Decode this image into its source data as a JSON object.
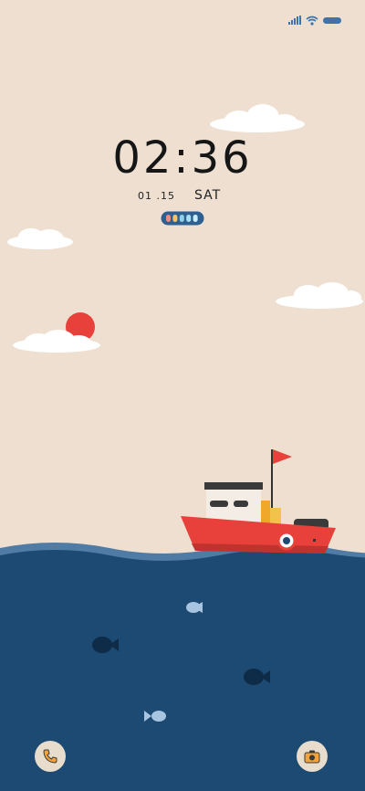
{
  "status_bar": {
    "signal_icon": "cellular-signal-icon",
    "wifi_icon": "wifi-icon",
    "battery_icon": "battery-icon"
  },
  "clock": {
    "time": "02:36",
    "date": "01 .15",
    "day": "SAT"
  },
  "battery_indicator": {
    "segment_colors": [
      "#f08a7a",
      "#f2c46d",
      "#8fd0e8",
      "#a9dff2",
      "#c9ecf8"
    ]
  },
  "shortcuts": {
    "left_icon": "phone-icon",
    "right_icon": "camera-icon"
  },
  "colors": {
    "background": "#eedfd0",
    "sea": "#1c4a72",
    "boat_hull": "#e8413c",
    "sun": "#e8413c"
  }
}
